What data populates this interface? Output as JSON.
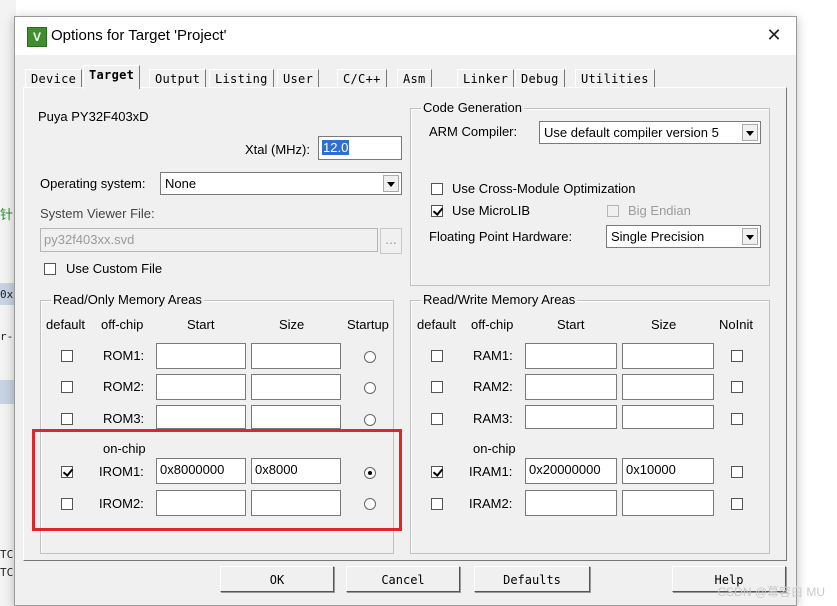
{
  "background": {
    "fragments": [
      "针",
      "0x",
      "r-",
      "TC",
      "TC"
    ]
  },
  "window": {
    "title": "Options for Target 'Project'",
    "icon_letter": "V",
    "close_glyph": "✕"
  },
  "tabs": [
    "Device",
    "Target",
    "Output",
    "Listing",
    "User",
    "C/C++",
    "Asm",
    "Linker",
    "Debug",
    "Utilities"
  ],
  "active_tab": "Target",
  "target": {
    "device_name": "Puya PY32F403xD",
    "xtal_label": "Xtal (MHz):",
    "xtal_value": "12.0",
    "os_label": "Operating system:",
    "os_value": "None",
    "svf_label": "System Viewer File:",
    "svf_value": "py32f403xx.svd",
    "browse_label": "...",
    "custom_file_label": "Use Custom File",
    "code_gen": {
      "title": "Code Generation",
      "compiler_label": "ARM Compiler:",
      "compiler_value": "Use default compiler version 5",
      "cross_module_label": "Use Cross-Module Optimization",
      "microlib_label": "Use MicroLIB",
      "big_endian_label": "Big Endian",
      "fpu_label": "Floating Point Hardware:",
      "fpu_value": "Single Precision"
    },
    "ro_area": {
      "title": "Read/Only Memory Areas",
      "headers": {
        "default": "default",
        "offchip": "off-chip",
        "start": "Start",
        "size": "Size",
        "startup": "Startup"
      },
      "onchip_label": "on-chip",
      "rows": [
        {
          "name": "ROM1:",
          "start": "",
          "size": ""
        },
        {
          "name": "ROM2:",
          "start": "",
          "size": ""
        },
        {
          "name": "ROM3:",
          "start": "",
          "size": ""
        },
        {
          "name": "IROM1:",
          "start": "0x8000000",
          "size": "0x8000"
        },
        {
          "name": "IROM2:",
          "start": "",
          "size": ""
        }
      ]
    },
    "rw_area": {
      "title": "Read/Write Memory Areas",
      "headers": {
        "default": "default",
        "offchip": "off-chip",
        "start": "Start",
        "size": "Size",
        "noinit": "NoInit"
      },
      "onchip_label": "on-chip",
      "rows": [
        {
          "name": "RAM1:",
          "start": "",
          "size": ""
        },
        {
          "name": "RAM2:",
          "start": "",
          "size": ""
        },
        {
          "name": "RAM3:",
          "start": "",
          "size": ""
        },
        {
          "name": "IRAM1:",
          "start": "0x20000000",
          "size": "0x10000"
        },
        {
          "name": "IRAM2:",
          "start": "",
          "size": ""
        }
      ]
    }
  },
  "buttons": {
    "ok": "OK",
    "cancel": "Cancel",
    "defaults": "Defaults",
    "help": "Help"
  },
  "watermark": "CSDN @幕容白 MU"
}
